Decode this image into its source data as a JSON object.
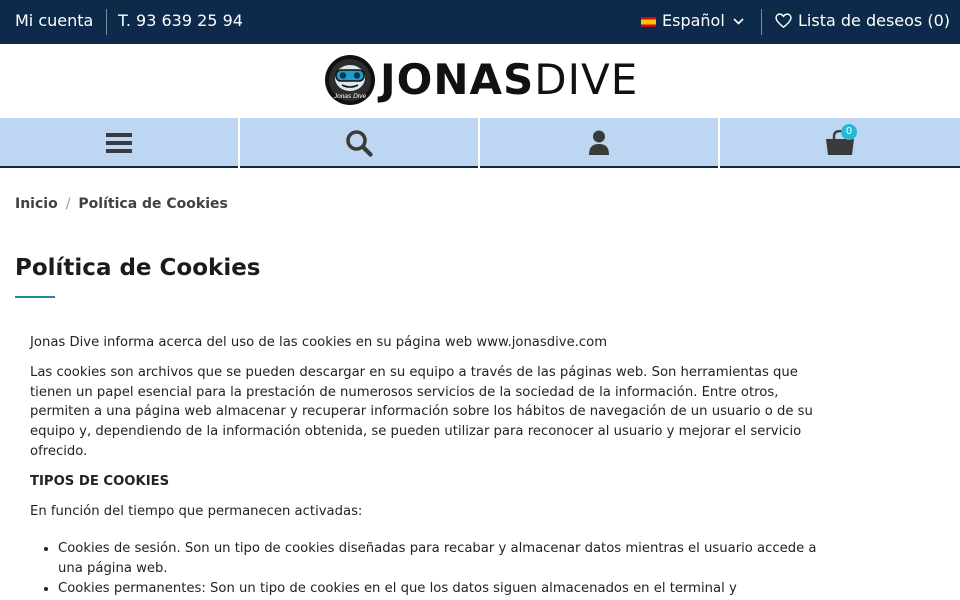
{
  "topbar": {
    "account": "Mi cuenta",
    "phone": "T. 93 639 25 94",
    "language": "Español",
    "wishlist": "Lista de deseos (0)"
  },
  "logo": {
    "bold": "JONAS",
    "light": "DIVE",
    "emblem_text": "Jonas Dive"
  },
  "nav": {
    "icons": [
      "menu-icon",
      "search-icon",
      "user-icon",
      "cart-icon"
    ],
    "cart_count": "0"
  },
  "breadcrumb": {
    "home": "Inicio",
    "separator": "/",
    "current": "Política de Cookies"
  },
  "page": {
    "title": "Política de Cookies"
  },
  "content": {
    "intro": "Jonas Dive informa acerca del uso de las cookies en su página web www.jonasdive.com",
    "paragraph": "Las cookies son archivos que se pueden descargar en su equipo a través de las páginas web. Son herramientas que tienen un papel esencial para la prestación de numerosos servicios de la sociedad de la información. Entre otros, permiten a una página web almacenar y recuperar información sobre los hábitos de navegación de un usuario o de su equipo y, dependiendo de la información obtenida, se pueden utilizar para reconocer al usuario y mejorar el servicio ofrecido.",
    "heading": "TIPOS DE COOKIES",
    "subheading": "En función del tiempo que permanecen activadas:",
    "list": [
      "Cookies de sesión. Son un tipo de cookies diseñadas para recabar y almacenar datos mientras el usuario accede a una página web.",
      "Cookies permanentes: Son un tipo de cookies en el que los datos siguen almacenados en el terminal y"
    ]
  },
  "colors": {
    "topbar_bg": "#0d2a4a",
    "navbar_bg": "#bdd6f1",
    "accent": "#1f8ca4",
    "badge": "#24b9d7"
  }
}
